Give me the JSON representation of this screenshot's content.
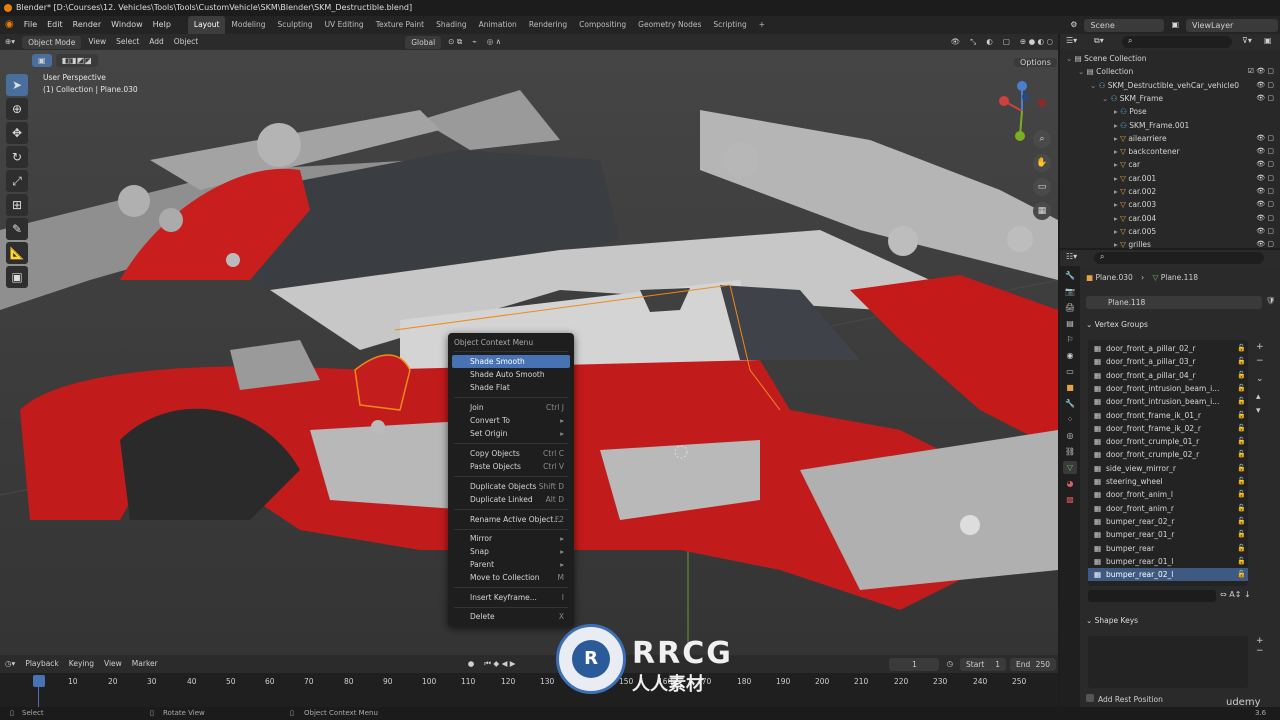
{
  "window_title": "Blender* [D:\\Courses\\12. Vehicles\\Tools\\Tools\\CustomVehicle\\SKM\\Blender\\SKM_Destructible.blend]",
  "menu": [
    "File",
    "Edit",
    "Render",
    "Window",
    "Help"
  ],
  "workspaces": [
    "Layout",
    "Modeling",
    "Sculpting",
    "UV Editing",
    "Texture Paint",
    "Shading",
    "Animation",
    "Rendering",
    "Compositing",
    "Geometry Nodes",
    "Scripting",
    "+"
  ],
  "scene": {
    "label": "Scene",
    "view_layer": "ViewLayer"
  },
  "viewport_header": {
    "mode": "Object Mode",
    "items": [
      "View",
      "Select",
      "Add",
      "Object"
    ],
    "transform": "Global",
    "options": "Options"
  },
  "overlay": {
    "line1": "User Perspective",
    "line2": "(1) Collection | Plane.030"
  },
  "gizmo": {
    "x": "X",
    "y": "Y",
    "z": "Z"
  },
  "context_menu": {
    "title": "Object Context Menu",
    "items": [
      {
        "label": "Shade Smooth",
        "shortcut": "",
        "highlight": true
      },
      {
        "label": "Shade Auto Smooth",
        "shortcut": ""
      },
      {
        "label": "Shade Flat",
        "shortcut": ""
      },
      {
        "label": "Join",
        "shortcut": "Ctrl J"
      },
      {
        "label": "Convert To",
        "shortcut": "▸"
      },
      {
        "label": "Set Origin",
        "shortcut": "▸"
      },
      {
        "label": "Copy Objects",
        "shortcut": "Ctrl C"
      },
      {
        "label": "Paste Objects",
        "shortcut": "Ctrl V"
      },
      {
        "label": "Duplicate Objects",
        "shortcut": "Shift D"
      },
      {
        "label": "Duplicate Linked",
        "shortcut": "Alt D"
      },
      {
        "label": "Rename Active Object...",
        "shortcut": "F2"
      },
      {
        "label": "Mirror",
        "shortcut": "▸"
      },
      {
        "label": "Snap",
        "shortcut": "▸"
      },
      {
        "label": "Parent",
        "shortcut": "▸"
      },
      {
        "label": "Move to Collection",
        "shortcut": "M"
      },
      {
        "label": "Insert Keyframe...",
        "shortcut": "I"
      },
      {
        "label": "Delete",
        "shortcut": "X"
      }
    ]
  },
  "timeline_header": {
    "items": [
      "Playback",
      "Keying",
      "View",
      "Marker"
    ],
    "current_frame": "1",
    "start_label": "Start",
    "start": "1",
    "end_label": "End",
    "end": "250"
  },
  "timeline_ticks": [
    "1",
    "10",
    "20",
    "30",
    "40",
    "50",
    "60",
    "70",
    "80",
    "90",
    "100",
    "110",
    "120",
    "130",
    "140",
    "150",
    "160",
    "170",
    "180",
    "190",
    "200",
    "210",
    "220",
    "230",
    "240",
    "250"
  ],
  "status_bar": {
    "select": "Select",
    "rotate": "Rotate View",
    "context": "Object Context Menu",
    "version": "3.6"
  },
  "outliner": [
    {
      "label": "Scene Collection",
      "depth": 0
    },
    {
      "label": "Collection",
      "depth": 1
    },
    {
      "label": "SKM_Destructible_vehCar_vehicle0",
      "depth": 2
    },
    {
      "label": "SKM_Frame",
      "depth": 3
    },
    {
      "label": "Pose",
      "depth": 4
    },
    {
      "label": "SKM_Frame.001",
      "depth": 4
    },
    {
      "label": "ailearriere",
      "depth": 4
    },
    {
      "label": "backcontener",
      "depth": 4
    },
    {
      "label": "car",
      "depth": 4
    },
    {
      "label": "car.001",
      "depth": 4
    },
    {
      "label": "car.002",
      "depth": 4
    },
    {
      "label": "car.003",
      "depth": 4
    },
    {
      "label": "car.004",
      "depth": 4
    },
    {
      "label": "car.005",
      "depth": 4
    },
    {
      "label": "grilles",
      "depth": 4
    }
  ],
  "properties": {
    "object": "Plane.030",
    "mesh": "Plane.118",
    "data_name": "Plane.118",
    "vertex_groups_title": "Vertex Groups",
    "vertex_groups": [
      "door_front_a_pillar_02_r",
      "door_front_a_pillar_03_r",
      "door_front_a_pillar_04_r",
      "door_front_intrusion_beam_i...",
      "door_front_intrusion_beam_i...",
      "door_front_frame_ik_01_r",
      "door_front_frame_ik_02_r",
      "door_front_crumple_01_r",
      "door_front_crumple_02_r",
      "side_view_mirror_r",
      "steering_wheel",
      "door_front_anim_l",
      "door_front_anim_r",
      "bumper_rear_02_r",
      "bumper_rear_01_r",
      "bumper_rear",
      "bumper_rear_01_l",
      "bumper_rear_02_l"
    ],
    "shape_keys_title": "Shape Keys",
    "add_rest": "Add Rest Position"
  },
  "watermark": {
    "brand": "RRCG",
    "sub": "人人素材",
    "udemy": "udemy"
  }
}
